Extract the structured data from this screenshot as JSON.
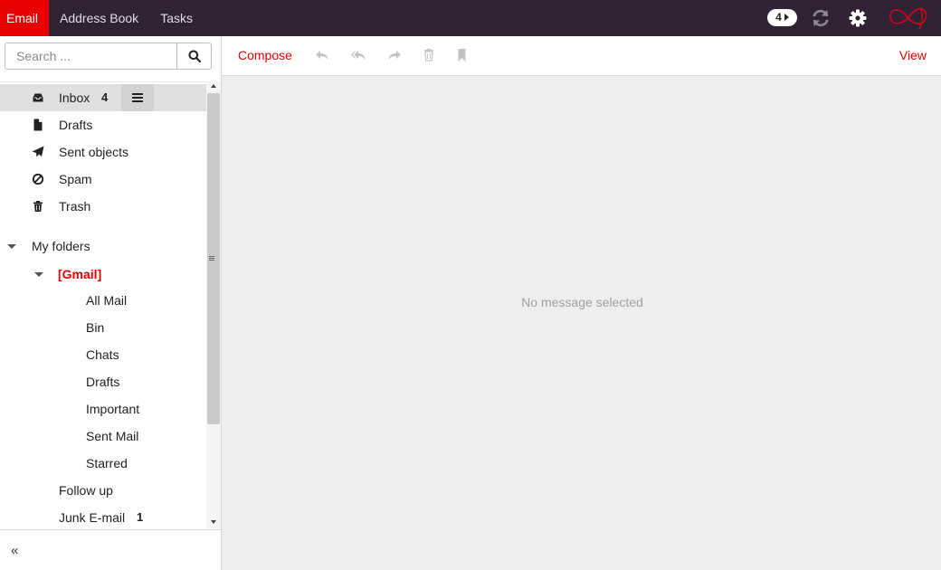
{
  "topnav": {
    "tabs": [
      {
        "label": "Email",
        "active": true
      },
      {
        "label": "Address Book",
        "active": false
      },
      {
        "label": "Tasks",
        "active": false
      }
    ],
    "notification_count": "4",
    "icons": [
      "refresh-icon",
      "gear-icon",
      "logo-icon"
    ]
  },
  "search": {
    "placeholder": "Search ...",
    "value": ""
  },
  "folders": {
    "inbox": {
      "label": "Inbox",
      "count": "4"
    },
    "drafts": {
      "label": "Drafts"
    },
    "sent": {
      "label": "Sent objects"
    },
    "spam": {
      "label": "Spam"
    },
    "trash": {
      "label": "Trash"
    },
    "my_folders": {
      "label": "My folders"
    },
    "gmail": {
      "label": "[Gmail]"
    },
    "gmail_children": [
      {
        "label": "All Mail"
      },
      {
        "label": "Bin"
      },
      {
        "label": "Chats"
      },
      {
        "label": "Drafts"
      },
      {
        "label": "Important"
      },
      {
        "label": "Sent Mail"
      },
      {
        "label": "Starred"
      }
    ],
    "follow_up": {
      "label": "Follow up"
    },
    "junk": {
      "label": "Junk E-mail",
      "count": "1"
    }
  },
  "toolbar": {
    "compose_label": "Compose",
    "view_label": "View",
    "icons": [
      "reply-icon",
      "reply-all-icon",
      "forward-icon",
      "delete-icon",
      "bookmark-icon"
    ]
  },
  "content": {
    "empty_message": "No message selected"
  },
  "colors": {
    "accent": "#e60000",
    "topbar": "#2e2233",
    "content_bg": "#eeeeee"
  }
}
